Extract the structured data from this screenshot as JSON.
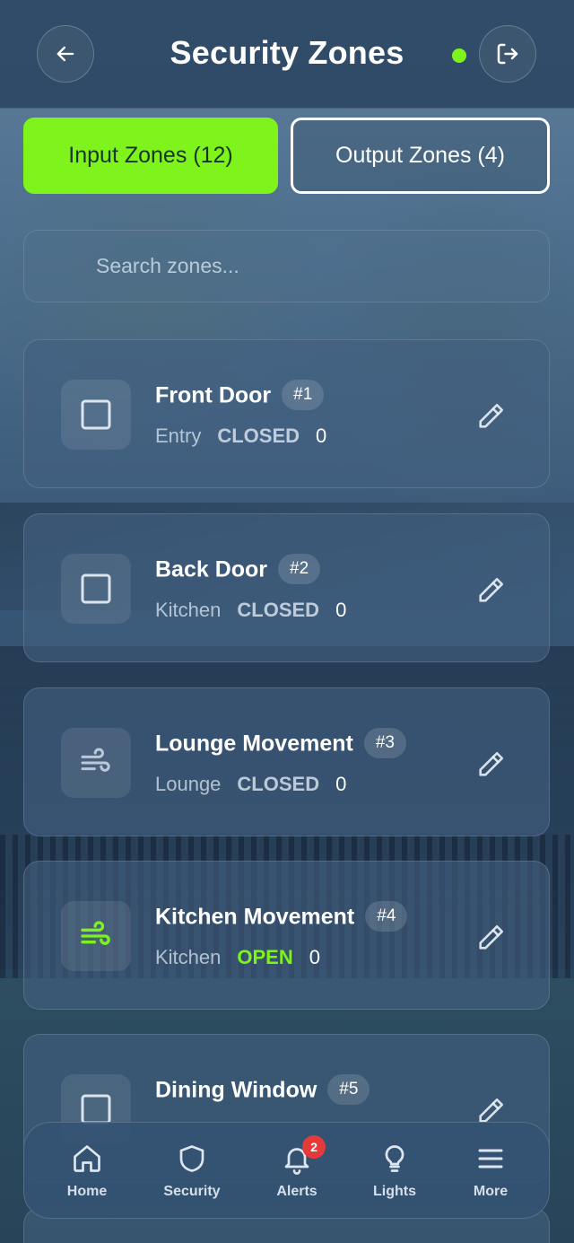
{
  "header": {
    "title": "Security Zones",
    "back_icon": "arrow-left-icon",
    "logout_icon": "logout-icon",
    "status_color": "#7df21d"
  },
  "tabs": [
    {
      "label": "Input Zones (12)",
      "active": true
    },
    {
      "label": "Output Zones (4)",
      "active": false
    }
  ],
  "search": {
    "placeholder": "Search zones..."
  },
  "zones": [
    {
      "name": "Front Door",
      "number": "#1",
      "location": "Entry",
      "state": "CLOSED",
      "count": "0",
      "icon": "square-icon",
      "open": false
    },
    {
      "name": "Back Door",
      "number": "#2",
      "location": "Kitchen",
      "state": "CLOSED",
      "count": "0",
      "icon": "square-icon",
      "open": false
    },
    {
      "name": "Lounge Movement",
      "number": "#3",
      "location": "Lounge",
      "state": "CLOSED",
      "count": "0",
      "icon": "wind-icon",
      "open": false
    },
    {
      "name": "Kitchen Movement",
      "number": "#4",
      "location": "Kitchen",
      "state": "OPEN",
      "count": "0",
      "icon": "wind-icon",
      "open": true
    },
    {
      "name": "Dining Window",
      "number": "#5",
      "location": "",
      "state": "",
      "count": "",
      "icon": "square-icon",
      "open": false
    }
  ],
  "nav": [
    {
      "label": "Home",
      "icon": "home-icon"
    },
    {
      "label": "Security",
      "icon": "shield-icon"
    },
    {
      "label": "Alerts",
      "icon": "bell-icon",
      "badge": "2"
    },
    {
      "label": "Lights",
      "icon": "lightbulb-icon"
    },
    {
      "label": "More",
      "icon": "menu-icon"
    }
  ],
  "colors": {
    "accent": "#7ff31c",
    "alert": "#e53a3a"
  }
}
